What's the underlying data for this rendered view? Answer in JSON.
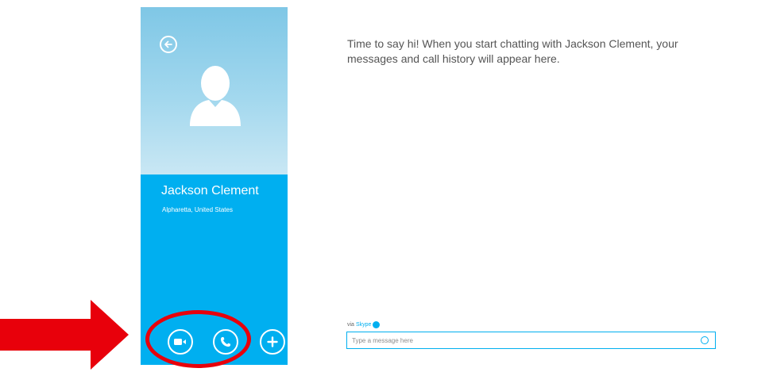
{
  "contact": {
    "name": "Jackson Clement",
    "location": "Alpharetta, United States"
  },
  "conversation": {
    "empty_message": "Time to say hi! When you start chatting with Jackson Clement, your messages and call history will appear here."
  },
  "composer": {
    "via_prefix": "via",
    "via_service": "Skype",
    "placeholder": "Type a message here"
  },
  "icons": {
    "back": "back-arrow-icon",
    "avatar": "default-avatar-icon",
    "video_call": "video-camera-icon",
    "voice_call": "phone-icon",
    "add": "plus-icon",
    "emoji": "smiley-icon"
  },
  "colors": {
    "accent": "#00aff0",
    "highlight": "#e8000b"
  }
}
